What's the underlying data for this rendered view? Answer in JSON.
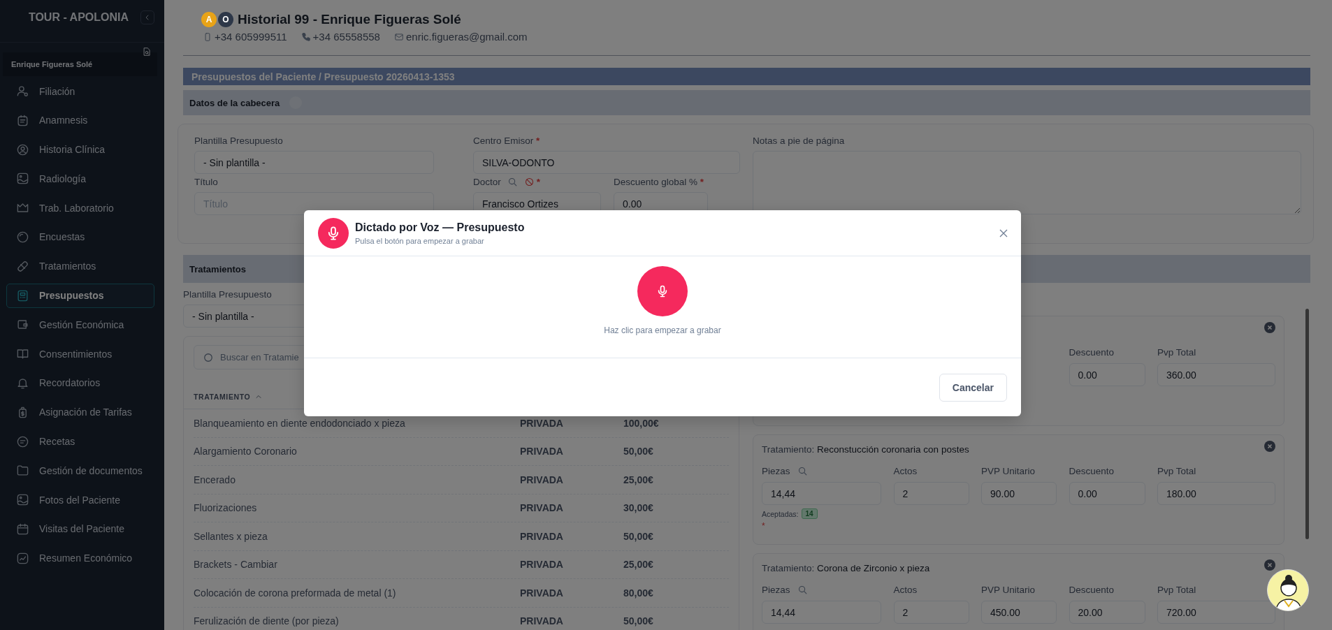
{
  "sidebar": {
    "title": "TOUR - APOLONIA",
    "patient": "Enrique Figueras Solé",
    "items": [
      {
        "label": "Filiación",
        "selected": false
      },
      {
        "label": "Anamnesis",
        "selected": false
      },
      {
        "label": "Historia Clínica",
        "selected": false
      },
      {
        "label": "Radiología",
        "selected": false
      },
      {
        "label": "Trab. Laboratorio",
        "selected": false
      },
      {
        "label": "Encuestas",
        "selected": false
      },
      {
        "label": "Tratamientos",
        "selected": false
      },
      {
        "label": "Presupuestos",
        "selected": true
      },
      {
        "label": "Gestión Económica",
        "selected": false
      },
      {
        "label": "Consentimientos",
        "selected": false
      },
      {
        "label": "Recordatorios",
        "selected": false
      },
      {
        "label": "Asignación de Tarifas",
        "selected": false
      },
      {
        "label": "Recetas",
        "selected": false
      },
      {
        "label": "Gestión de documentos",
        "selected": false
      },
      {
        "label": "Fotos del Paciente",
        "selected": false
      },
      {
        "label": "Visitas del Paciente",
        "selected": false
      },
      {
        "label": "Resumen Económico",
        "selected": false
      }
    ]
  },
  "header": {
    "avatars": [
      {
        "initial": "A",
        "color": "#e8a317"
      },
      {
        "initial": "O",
        "color": "#2d3748"
      }
    ],
    "title": "Historial 99 - Enrique Figueras Solé",
    "mobile": "+34 605999511",
    "phone": "+34 65558558",
    "email": "enric.figueras@gmail.com"
  },
  "breadcrumb": "Presupuestos del Paciente / Presupuesto 20260413-1353",
  "header_section": {
    "title": "Datos de la cabecera",
    "template": {
      "label": "Plantilla Presupuesto",
      "value": "- Sin plantilla -"
    },
    "title_field": {
      "label": "Título",
      "placeholder": "Título"
    },
    "center": {
      "label": "Centro Emisor",
      "required": true,
      "value": "SILVA-ODONTO"
    },
    "doctor": {
      "label": "Doctor",
      "required": true,
      "value": "Francisco Ortizes"
    },
    "discount": {
      "label": "Descuento global %",
      "required": true,
      "value": "0.00"
    },
    "notes": {
      "label": "Notas a pie de página"
    }
  },
  "treatments": {
    "title": "Tratamientos",
    "template": {
      "label": "Plantilla Presupuesto",
      "value": "- Sin plantilla -"
    },
    "search": {
      "placeholder": "Buscar en Tratamie"
    },
    "column_1": "TRATAMIENTO",
    "rows": [
      {
        "name": "Blanqueamiento en diente endodonciado x pieza",
        "type": "PRIVADA",
        "price": "100,00€"
      },
      {
        "name": "Alargamiento Coronario",
        "type": "PRIVADA",
        "price": "50,00€"
      },
      {
        "name": "Encerado",
        "type": "PRIVADA",
        "price": "25,00€"
      },
      {
        "name": "Fluorizaciones",
        "type": "PRIVADA",
        "price": "30,00€"
      },
      {
        "name": "Sellantes x pieza",
        "type": "PRIVADA",
        "price": "50,00€"
      },
      {
        "name": "Brackets - Cambiar",
        "type": "PRIVADA",
        "price": "25,00€"
      },
      {
        "name": "Colocación de corona preformada de metal (1)",
        "type": "PRIVADA",
        "price": "80,00€"
      },
      {
        "name": "Ferulización de diente (por pieza)",
        "type": "PRIVADA",
        "price": "50,00€"
      }
    ]
  },
  "budget_items": [
    {
      "fields": [
        {
          "label": "Descuento",
          "value": "0.00"
        },
        {
          "label": "Pvp Total",
          "value": "360.00"
        }
      ]
    },
    {
      "title_label": "Tratamiento:",
      "title": "Reconstucción coronaria con postes",
      "fields": [
        {
          "label": "Piezas",
          "value": "14,44",
          "search": true
        },
        {
          "label": "Actos",
          "value": "2"
        },
        {
          "label": "PVP Unitario",
          "value": "90.00"
        },
        {
          "label": "Descuento",
          "value": "0.00"
        },
        {
          "label": "Pvp Total",
          "value": "180.00"
        }
      ],
      "accepted_label": "Aceptadas:",
      "accepted": [
        "14"
      ],
      "note": "*"
    },
    {
      "title_label": "Tratamiento:",
      "title": "Corona de Zirconio x pieza",
      "fields": [
        {
          "label": "Piezas",
          "value": "14,44",
          "search": true
        },
        {
          "label": "Actos",
          "value": "2"
        },
        {
          "label": "PVP Unitario",
          "value": "450.00"
        },
        {
          "label": "Descuento",
          "value": "20.00"
        },
        {
          "label": "Pvp Total",
          "value": "720.00"
        }
      ]
    }
  ],
  "modal": {
    "title": "Dictado por Voz — Presupuesto",
    "subtitle": "Pulsa el botón para empezar a grabar",
    "hint": "Haz clic para empezar a grabar",
    "cancel": "Cancelar"
  }
}
